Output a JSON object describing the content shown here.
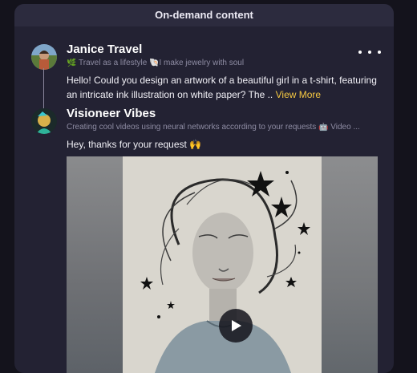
{
  "panel": {
    "title": "On-demand content"
  },
  "posts": [
    {
      "author": "Janice Travel",
      "subtitle": "🌿 Travel as a lifestyle 🐚I make jewelry with soul",
      "text": "Hello! Could you design an artwork of a beautiful girl in a t-shirt, featuring an intricate ink illustration on white paper? The ..",
      "more_label": "View More"
    },
    {
      "author": "Visioneer Vibes",
      "subtitle": "Creating cool videos using neural networks according to your requests 🤖 Video ...",
      "text": "Hey, thanks for your request 🙌"
    }
  ],
  "icons": {
    "menu": "more-horizontal-icon",
    "play": "play-icon"
  },
  "colors": {
    "accent_link": "#f5c842",
    "panel_bg": "#232233",
    "page_bg": "#14131c"
  }
}
